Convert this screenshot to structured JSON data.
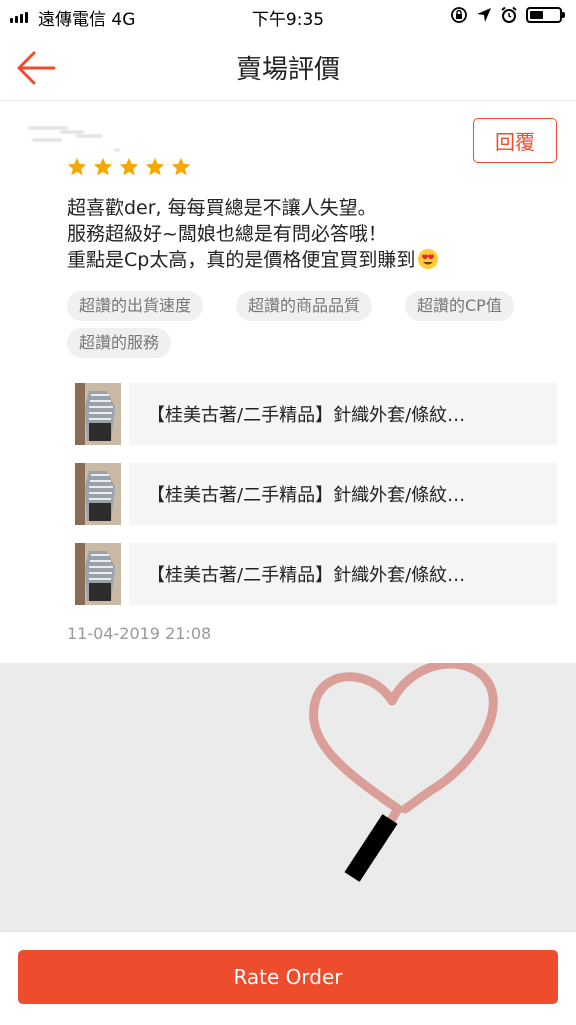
{
  "status_bar": {
    "carrier": "遠傳電信  4G",
    "time": "下午9:35",
    "battery_level": 0.45
  },
  "nav": {
    "title": "賣場評價"
  },
  "review": {
    "rating": 5,
    "reply_label": "回覆",
    "text_lines": [
      "超喜歡der, 每每買總是不讓人失望。",
      "服務超級好~闆娘也總是有問必答哦！",
      "重點是Cp太高，真的是價格便宜買到賺到"
    ],
    "emoji": "heart-eyes-emoji",
    "tags": [
      "超讚的出貨速度",
      "超讚的商品品質",
      "超讚的CP值",
      "超讚的服務"
    ],
    "products": [
      {
        "name": "【桂美古著/二手精品】針織外套/條紋…"
      },
      {
        "name": "【桂美古著/二手精品】針織外套/條紋…"
      },
      {
        "name": "【桂美古著/二手精品】針織外套/條紋…"
      }
    ],
    "time": "11-04-2019 21:08"
  },
  "bottom": {
    "rate_label": "Rate Order"
  },
  "colors": {
    "accent": "#ee4d2d",
    "star": "#f6a700",
    "background_gray": "#ebebeb"
  }
}
